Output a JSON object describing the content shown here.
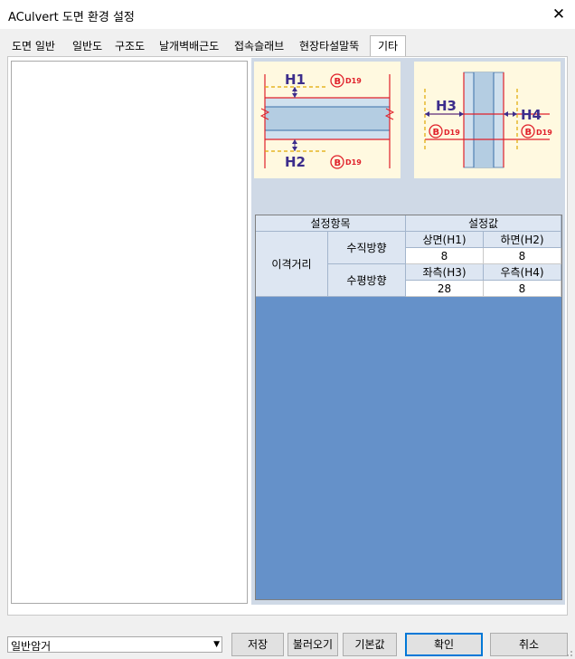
{
  "window": {
    "title": "ACulvert 도면 환경 설정",
    "close_glyph": "✕"
  },
  "tabs": [
    {
      "label": "도면 일반",
      "active": false
    },
    {
      "label": "일반도",
      "active": false
    },
    {
      "label": "구조도",
      "active": false
    },
    {
      "label": "날개벽배근도",
      "active": false
    },
    {
      "label": "접속슬래브",
      "active": false
    },
    {
      "label": "현장타설말뚝",
      "active": false
    },
    {
      "label": "기타",
      "active": true
    }
  ],
  "diagrams": {
    "vertical": {
      "top_label": "H1",
      "bottom_label": "H2",
      "badge_letter": "B",
      "badge_text": "D19"
    },
    "horizontal": {
      "left_label": "H3",
      "right_label": "H4",
      "badge_letter": "B",
      "badge_text": "D19"
    }
  },
  "table": {
    "header_item": "설정항목",
    "header_value": "설정값",
    "group_label": "이격거리",
    "rows": [
      {
        "direction": "수직방향",
        "col1_label": "상면(H1)",
        "col2_label": "하면(H2)",
        "col1_value": "8",
        "col2_value": "8"
      },
      {
        "direction": "수평방향",
        "col1_label": "좌측(H3)",
        "col2_label": "우측(H4)",
        "col1_value": "28",
        "col2_value": "8"
      }
    ]
  },
  "bottom": {
    "combo_value": "일반암거",
    "save_label": "저장",
    "load_label": "불러오기",
    "default_label": "기본값",
    "ok_label": "확인",
    "cancel_label": "취소"
  },
  "colors": {
    "table_bg": "#6591c9",
    "diagram_bg": "#fff9e0",
    "rebar_red": "#e0202a",
    "dim_purple": "#3c2d8c",
    "dash_yellow": "#e0a800"
  }
}
